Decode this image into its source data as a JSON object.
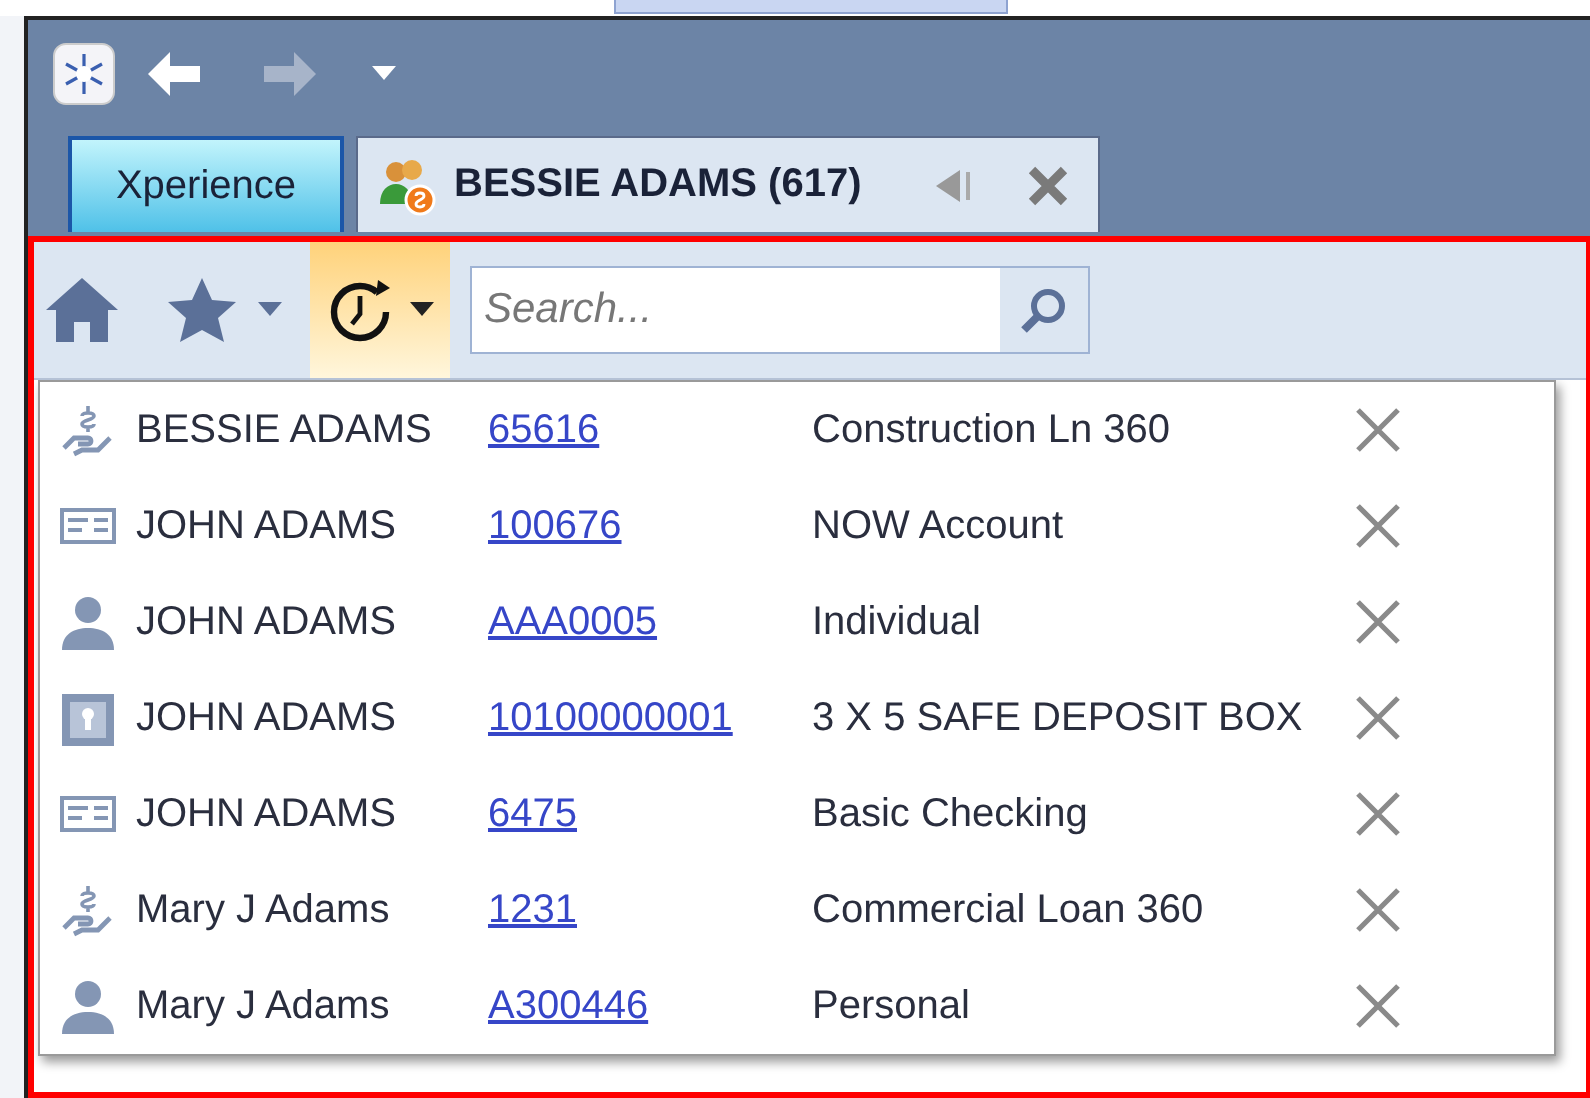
{
  "tabs": [
    {
      "label": "Xperience",
      "kind": "home",
      "selected": false
    },
    {
      "label": "BESSIE ADAMS (617)",
      "kind": "record",
      "selected": true
    }
  ],
  "toolbar": {
    "history_expanded": true,
    "search": {
      "placeholder": "Search..."
    }
  },
  "recent_items": [
    {
      "kind": "loan",
      "name": "BESSIE ADAMS",
      "number": "65616",
      "description": "Construction Ln 360"
    },
    {
      "kind": "deposit",
      "name": "JOHN ADAMS",
      "number": "100676",
      "description": "NOW Account"
    },
    {
      "kind": "person",
      "name": "JOHN ADAMS",
      "number": "AAA0005",
      "description": "Individual"
    },
    {
      "kind": "safe_box",
      "name": "JOHN ADAMS",
      "number": "10100000001",
      "description": "3 X 5 SAFE DEPOSIT BOX"
    },
    {
      "kind": "deposit",
      "name": "JOHN ADAMS",
      "number": "6475",
      "description": "Basic Checking"
    },
    {
      "kind": "loan",
      "name": "Mary J Adams",
      "number": "1231",
      "description": "Commercial Loan 360"
    },
    {
      "kind": "person",
      "name": "Mary J Adams",
      "number": "A300446",
      "description": "Personal"
    }
  ]
}
